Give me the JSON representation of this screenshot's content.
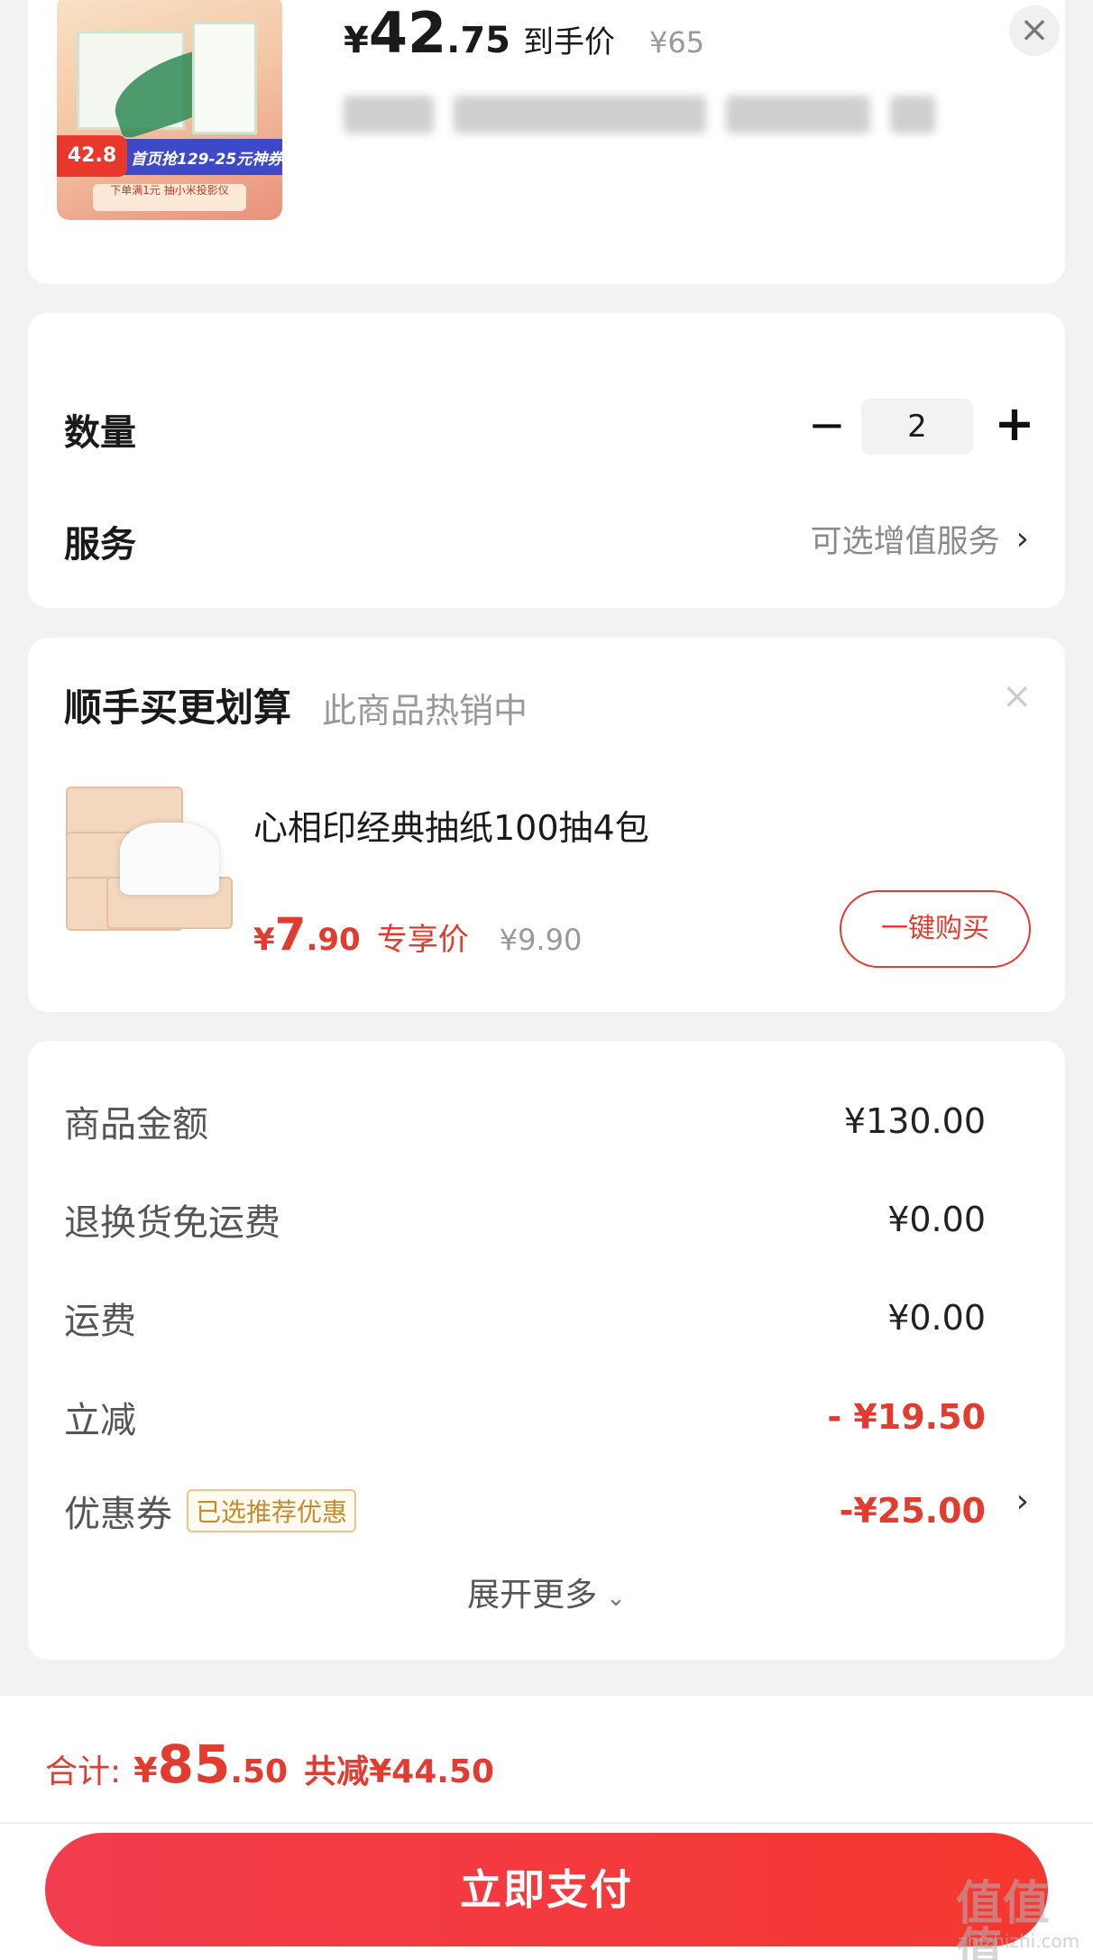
{
  "product": {
    "price_symbol": "¥",
    "price_int": "42",
    "price_dec": ".75",
    "price_label": "到手价",
    "original_price": "¥65",
    "image_badge_price": "42.8",
    "image_banner": "首页抢129-25元神券",
    "image_sub": "下单满1元 抽小米投影仪"
  },
  "quantity": {
    "label": "数量",
    "value": "2",
    "minus": "−",
    "plus": "+"
  },
  "service": {
    "label": "服务",
    "link": "可选增值服务"
  },
  "upsell": {
    "title": "顺手买更划算",
    "subtitle": "此商品热销中",
    "item_name": "心相印经典抽纸100抽4包",
    "price_symbol": "¥",
    "price_int": "7",
    "price_dec": ".90",
    "price_label": "专享价",
    "original_price": "¥9.90",
    "buy_button": "一键购买"
  },
  "summary": {
    "rows": [
      {
        "label": "商品金额",
        "value": "¥130.00"
      },
      {
        "label": "退换货免运费",
        "value": "¥0.00"
      },
      {
        "label": "运费",
        "value": "¥0.00"
      },
      {
        "label": "立减",
        "value": "- ¥19.50"
      },
      {
        "label": "优惠券",
        "tag": "已选推荐优惠",
        "value": "-¥25.00"
      }
    ],
    "expand": "展开更多"
  },
  "footer": {
    "total_label": "合计:",
    "total_symbol": "¥",
    "total_int": "85",
    "total_dec": ".50",
    "total_saved": "共减¥44.50",
    "pay_button": "立即支付"
  },
  "watermark": {
    "logo": "值值值",
    "site": "zhizhizhi.com"
  },
  "colors": {
    "accent_red": "#e23b2f",
    "background": "#f2f2f2",
    "coupon_tag": "#c88a2a"
  }
}
